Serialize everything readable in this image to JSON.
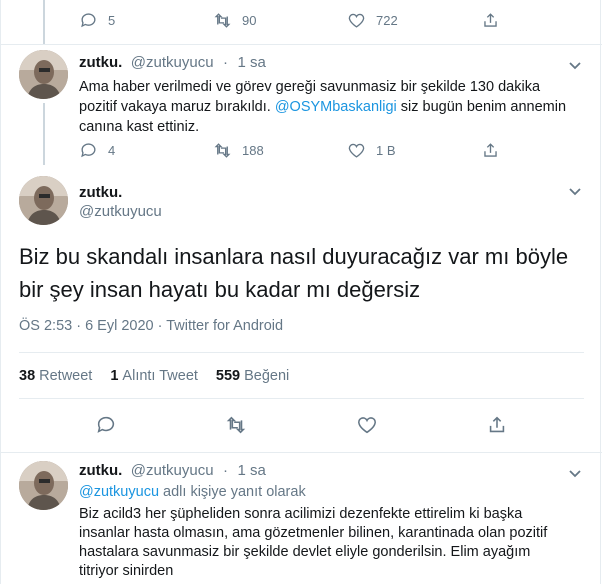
{
  "top_tweet": {
    "reply_count": "5",
    "retweet_count": "90",
    "like_count": "722"
  },
  "tweet1": {
    "name": "zutku.",
    "handle": "@zutkuyucu",
    "time": "1 sa",
    "text_before": "Ama haber verilmedi ve görev gereği savunmasiz bir şekilde 130 dakika pozitif vakaya maruz bırakıldı. ",
    "mention": "@OSYMbaskanligi",
    "text_after": " siz bugün benim annemin canına kast ettiniz.",
    "reply_count": "4",
    "retweet_count": "188",
    "like_count": "1 B"
  },
  "main_tweet": {
    "name": "zutku.",
    "handle": "@zutkuyucu",
    "text": "Biz bu skandalı insanlara nasıl duyuracağız var mı böyle bir şey insan hayatı bu kadar mı değersiz",
    "meta": "ÖS 2:53 · 6 Eyl 2020 · Twitter for Android",
    "retweets_value": "38",
    "retweets_label": "Retweet",
    "quotes_value": "1",
    "quotes_label": "Alıntı Tweet",
    "likes_value": "559",
    "likes_label": "Beğeni"
  },
  "tweet3": {
    "name": "zutku.",
    "handle": "@zutkuyucu",
    "time": "1 sa",
    "reply_mention": "@zutkuyucu",
    "reply_suffix": " adlı kişiye yanıt olarak",
    "text": "Biz acild3 her şüpheliden sonra acilimizi dezenfekte ettirelim ki başka insanlar hasta olmasın, ama gözetmenler bilinen, karantinada olan pozitif hastalara savunmasiz bir şekilde devlet eliyle gonderilsin. Elim ayağım titriyor sinirden"
  },
  "colors": {
    "link": "#1b95e0",
    "muted": "#657786",
    "text": "#14171a",
    "border": "#e6ecf0"
  }
}
